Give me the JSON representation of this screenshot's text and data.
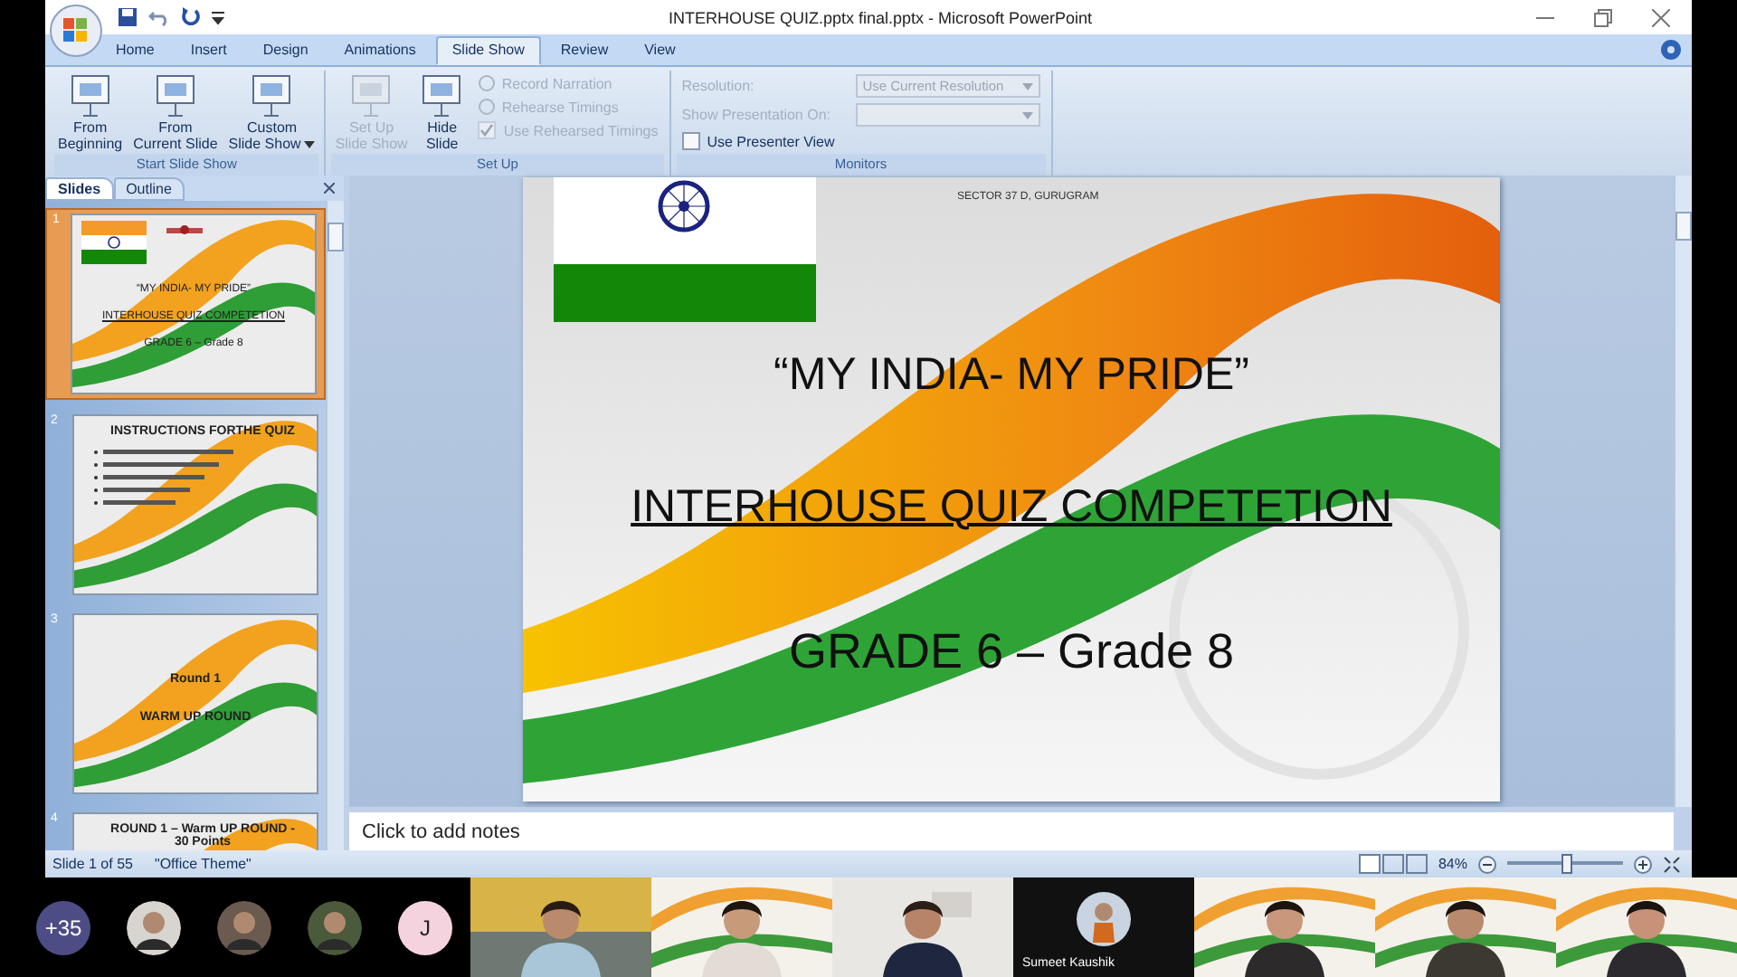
{
  "window": {
    "title": "INTERHOUSE QUIZ.pptx final.pptx - Microsoft PowerPoint"
  },
  "tabs": [
    {
      "label": "Home",
      "selected": false
    },
    {
      "label": "Insert",
      "selected": false
    },
    {
      "label": "Design",
      "selected": false
    },
    {
      "label": "Animations",
      "selected": false
    },
    {
      "label": "Slide Show",
      "selected": true
    },
    {
      "label": "Review",
      "selected": false
    },
    {
      "label": "View",
      "selected": false
    }
  ],
  "ribbon": {
    "groups": [
      {
        "label": "Start Slide Show",
        "items": [
          {
            "kind": "large",
            "lines": [
              "From",
              "Beginning"
            ],
            "disabled": false
          },
          {
            "kind": "large",
            "lines": [
              "From",
              "Current Slide"
            ],
            "disabled": false
          },
          {
            "kind": "large",
            "lines": [
              "Custom",
              "Slide Show"
            ],
            "disabled": false,
            "menu": true
          }
        ]
      },
      {
        "label": "Set Up",
        "items": [
          {
            "kind": "large",
            "lines": [
              "Set Up",
              "Slide Show"
            ],
            "disabled": true
          },
          {
            "kind": "large",
            "lines": [
              "Hide",
              "Slide"
            ],
            "disabled": false
          },
          {
            "kind": "stack",
            "items": [
              {
                "kind": "small",
                "label": "Record Narration",
                "disabled": true
              },
              {
                "kind": "small",
                "label": "Rehearse Timings",
                "disabled": true
              },
              {
                "kind": "check",
                "label": "Use Rehearsed Timings",
                "checked": true,
                "disabled": true
              }
            ]
          }
        ]
      },
      {
        "label": "Monitors",
        "items": [
          {
            "kind": "stack",
            "items": [
              {
                "kind": "field",
                "label": "Resolution:",
                "value": "Use Current Resolution",
                "disabled": true
              },
              {
                "kind": "field",
                "label": "Show Presentation On:",
                "disabled": true
              },
              {
                "kind": "check",
                "label": "Use Presenter View",
                "checked": false,
                "disabled": false
              }
            ]
          }
        ]
      }
    ]
  },
  "pane_tabs": [
    {
      "label": "Slides",
      "selected": true
    },
    {
      "label": "Outline",
      "selected": false
    }
  ],
  "thumbnails": [
    {
      "number": "1",
      "selected": true,
      "kind": "title",
      "lines": [
        {
          "text": "“MY INDIA- MY PRIDE”",
          "kind": "plain"
        },
        {
          "text": "INTERHOUSE QUIZ COMPETETION",
          "kind": "underline"
        },
        {
          "text": "GRADE 6 – Grade 8",
          "kind": "plain"
        }
      ]
    },
    {
      "number": "2",
      "selected": false,
      "kind": "list",
      "lines": [
        {
          "text": "INSTRUCTIONS FORTHE QUIZ",
          "kind": "heading"
        }
      ]
    },
    {
      "number": "3",
      "selected": false,
      "kind": "section",
      "lines": [
        {
          "text": "Round 1",
          "kind": "heading"
        },
        {
          "text": "WARM UP ROUND",
          "kind": "heading"
        }
      ]
    },
    {
      "number": "4",
      "selected": false,
      "kind": "heading",
      "lines": [
        {
          "text": "ROUND 1 – Warm UP ROUND - 30 Points",
          "kind": "heading"
        }
      ]
    }
  ],
  "slide": {
    "kind": "title",
    "header": "SECTOR 37 D, GURUGRAM",
    "lines": [
      {
        "text": "“MY INDIA- MY PRIDE”",
        "kind": "plain"
      },
      {
        "text": "INTERHOUSE QUIZ COMPETETION",
        "kind": "underline"
      },
      {
        "text": "GRADE 6 – Grade 8",
        "kind": "plain"
      }
    ]
  },
  "notes": {
    "placeholder": "Click to add notes"
  },
  "status_bar": {
    "items": [
      "Slide 1 of 55",
      "\"Office Theme\""
    ],
    "zoom": "84%",
    "zoom_slider": {
      "level": 0.5
    }
  },
  "participants": [
    {
      "kind": "count",
      "label": "+35"
    },
    {
      "kind": "avatar"
    },
    {
      "kind": "avatar"
    },
    {
      "kind": "avatar"
    },
    {
      "kind": "initial",
      "label": "J"
    }
  ],
  "tiles": [
    {
      "kind": "picture"
    },
    {
      "kind": "picture"
    },
    {
      "kind": "picture"
    },
    {
      "kind": "name",
      "name": "Sumeet Kaushik"
    },
    {
      "kind": "picture"
    },
    {
      "kind": "picture"
    },
    {
      "kind": "picture"
    }
  ]
}
